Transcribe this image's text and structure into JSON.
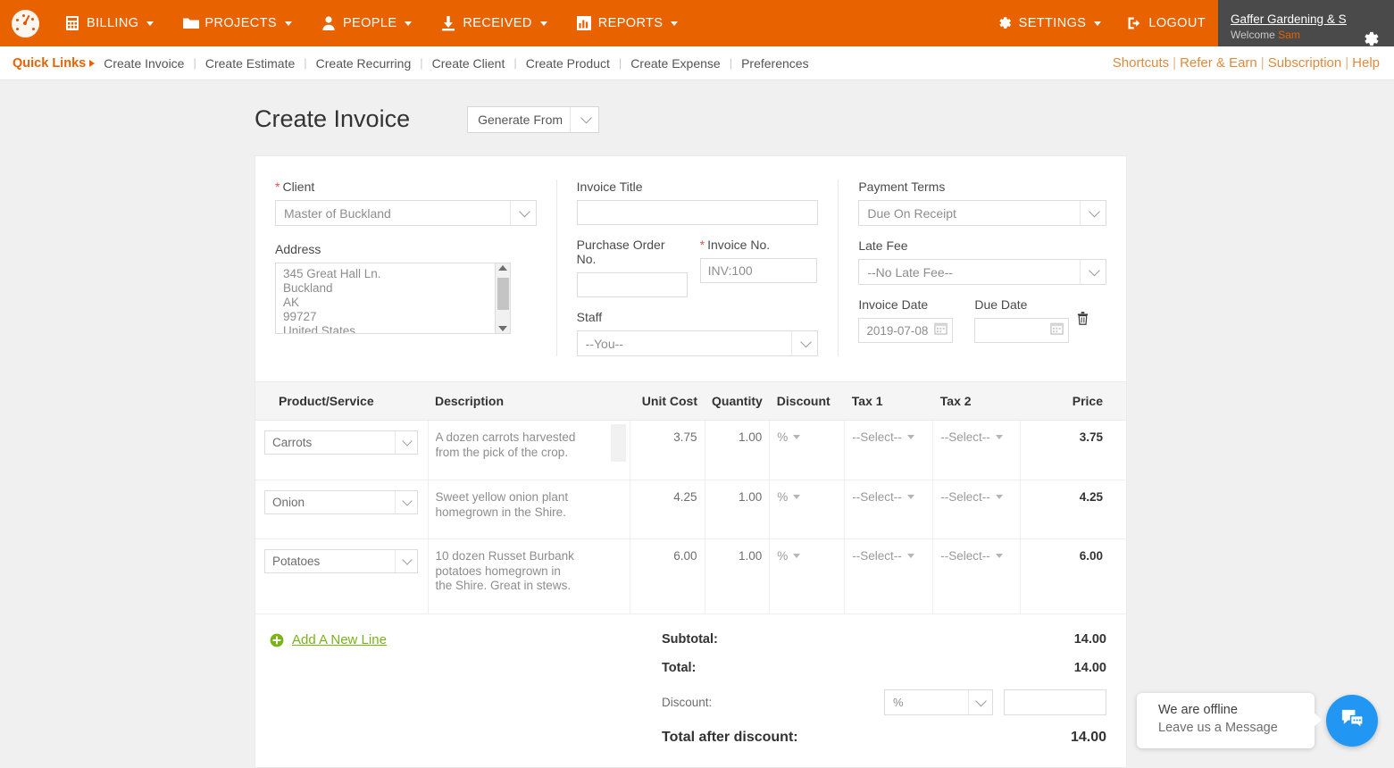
{
  "nav": {
    "logo_icon": "gauge-logo-icon",
    "items": [
      {
        "label": "BILLING",
        "icon": "calculator-icon",
        "has_caret": true
      },
      {
        "label": "PROJECTS",
        "icon": "folder-icon",
        "has_caret": true
      },
      {
        "label": "PEOPLE",
        "icon": "person-icon",
        "has_caret": true
      },
      {
        "label": "RECEIVED",
        "icon": "download-icon",
        "has_caret": true
      },
      {
        "label": "REPORTS",
        "icon": "bar-chart-icon",
        "has_caret": true
      }
    ],
    "settings_label": "SETTINGS",
    "logout_label": "LOGOUT",
    "company": "Gaffer Gardening & Sup...",
    "welcome_prefix": "Welcome",
    "welcome_name": "Sam",
    "accent_orange": "#e96200",
    "userbox_bg": "#4a4a4a"
  },
  "quicklinks": {
    "title": "Quick Links",
    "links": [
      "Create Invoice",
      "Create Estimate",
      "Create Recurring",
      "Create Client",
      "Create Product",
      "Create Expense",
      "Preferences"
    ],
    "right_links": [
      "Shortcuts",
      "Refer & Earn",
      "Subscription",
      "Help"
    ]
  },
  "page": {
    "title": "Create Invoice",
    "generate_from": "Generate From"
  },
  "form": {
    "client_label": "Client",
    "client_value": "Master of Buckland",
    "address_label": "Address",
    "address_lines": [
      "345 Great Hall Ln.",
      "Buckland",
      "AK",
      "99727",
      "United States"
    ],
    "invoice_title_label": "Invoice Title",
    "invoice_title_value": "",
    "po_label": "Purchase Order No.",
    "po_value": "",
    "invoice_no_label": "Invoice No.",
    "invoice_no_value": "INV:100",
    "staff_label": "Staff",
    "staff_value": "--You--",
    "payment_terms_label": "Payment Terms",
    "payment_terms_value": "Due On Receipt",
    "late_fee_label": "Late Fee",
    "late_fee_value": "--No Late Fee--",
    "invoice_date_label": "Invoice Date",
    "invoice_date_value": "2019-07-08",
    "due_date_label": "Due Date",
    "due_date_value": ""
  },
  "items_table": {
    "columns": [
      "Product/Service",
      "Description",
      "Unit Cost",
      "Quantity",
      "Discount",
      "Tax 1",
      "Tax 2",
      "Price"
    ],
    "rows": [
      {
        "product": "Carrots",
        "description": "A dozen carrots harvested from the pick of the crop.",
        "unit_cost": "3.75",
        "quantity": "1.00",
        "discount": "%",
        "tax1": "--Select--",
        "tax2": "--Select--",
        "price": "3.75",
        "has_scrollbar": true
      },
      {
        "product": "Onion",
        "description": "Sweet yellow onion plant homegrown in the Shire.",
        "unit_cost": "4.25",
        "quantity": "1.00",
        "discount": "%",
        "tax1": "--Select--",
        "tax2": "--Select--",
        "price": "4.25",
        "has_scrollbar": false
      },
      {
        "product": "Potatoes",
        "description": "10 dozen Russet Burbank potatoes homegrown in the Shire. Great in stews.",
        "unit_cost": "6.00",
        "quantity": "1.00",
        "discount": "%",
        "tax1": "--Select--",
        "tax2": "--Select--",
        "price": "6.00",
        "has_scrollbar": false
      }
    ]
  },
  "totals": {
    "add_line_label": "Add A New Line",
    "subtotal_label": "Subtotal:",
    "subtotal_value": "14.00",
    "total_label": "Total:",
    "total_value": "14.00",
    "discount_label": "Discount:",
    "discount_type": "%",
    "discount_value": "",
    "total_after_label": "Total after discount:",
    "total_after_value": "14.00"
  },
  "chat": {
    "line1": "We are offline",
    "line2": "Leave us a Message",
    "icon": "chat-bubbles-icon",
    "color": "#2196f3"
  }
}
